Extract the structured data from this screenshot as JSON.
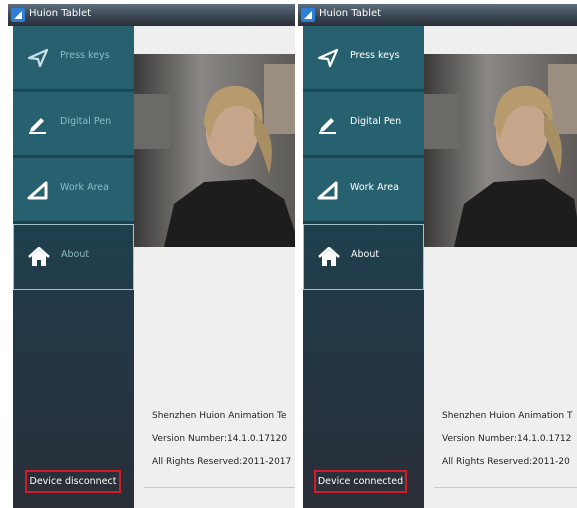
{
  "window": {
    "title": "Huion Tablet"
  },
  "nav": [
    {
      "label": "Press keys",
      "icon": "paper-plane-icon"
    },
    {
      "label": "Digital Pen",
      "icon": "pen-icon"
    },
    {
      "label": "Work Area",
      "icon": "triangle-icon"
    },
    {
      "label": "About",
      "icon": "home-icon"
    }
  ],
  "about": {
    "company": "Shenzhen Huion Animation Te",
    "version": "Version Number:14.1.0.17120",
    "rights": "All Rights Reserved:2011-2017"
  },
  "about_right": {
    "company": "Shenzhen Huion Animation T",
    "version": "Version Number:14.1.0.1712",
    "rights": "All Rights Reserved:2011-20"
  },
  "status": {
    "left": "Device disconnect",
    "right": "Device connected"
  },
  "colors": {
    "nav_tile": "#276170",
    "sidebar": "#1c4451",
    "status_outline": "#d21c27",
    "content_bg": "#efefef"
  }
}
